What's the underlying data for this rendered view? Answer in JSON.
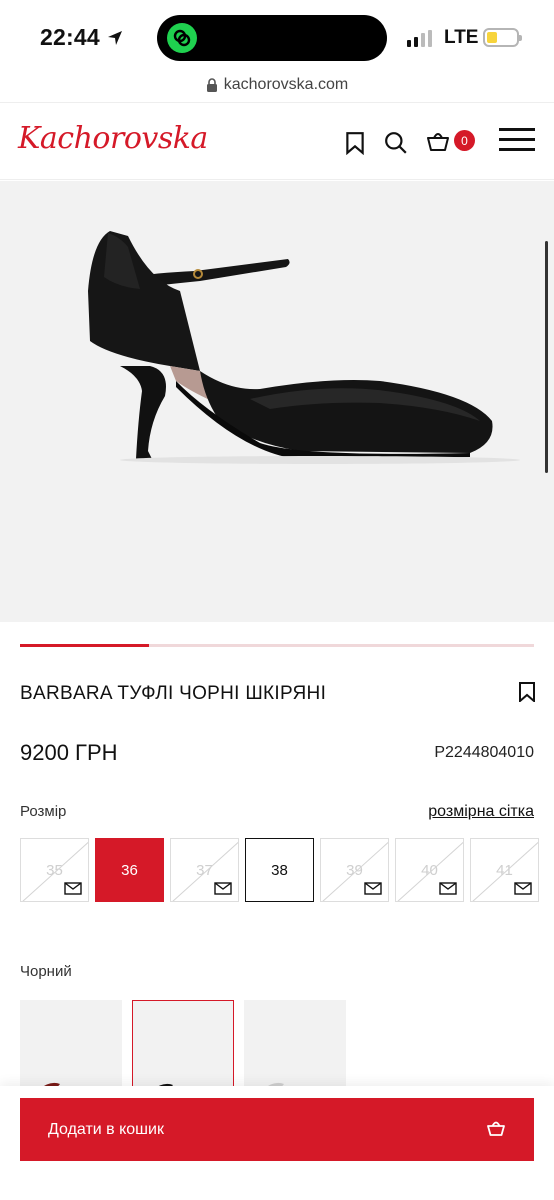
{
  "status_bar": {
    "time": "22:44",
    "network": "LTE"
  },
  "browser": {
    "url": "kachorovska.com"
  },
  "header": {
    "logo": "Kachorovska",
    "cart_count": "0"
  },
  "product": {
    "image_progress": 0.25,
    "title": "BARBARA ТУФЛІ ЧОРНІ ШКІРЯНІ",
    "price": "9200 ГРН",
    "sku": "P2244804010"
  },
  "sizes": {
    "label": "Розмір",
    "guide_link": "розмірна сітка",
    "options": [
      {
        "value": "35",
        "state": "unavailable"
      },
      {
        "value": "36",
        "state": "selected"
      },
      {
        "value": "37",
        "state": "unavailable"
      },
      {
        "value": "38",
        "state": "available"
      },
      {
        "value": "39",
        "state": "unavailable"
      },
      {
        "value": "40",
        "state": "unavailable"
      },
      {
        "value": "41",
        "state": "unavailable"
      }
    ]
  },
  "color": {
    "label": "Чорний"
  },
  "cta": {
    "add_to_cart": "Додати в кошик"
  },
  "colors": {
    "accent": "#d51928"
  }
}
